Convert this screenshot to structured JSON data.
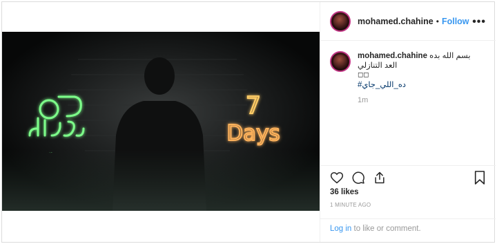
{
  "post": {
    "username": "mohamed.chahine",
    "dot": "•",
    "follow_label": "Follow",
    "more_label": "•••",
    "caption_line1": "بسم الله بده العد التنازلي",
    "caption_line2": "◻◻",
    "hashtag": "#ده_اللي_جاي",
    "time_short": "1m",
    "likes": "36 likes",
    "time_ago": "1 MINUTE AGO",
    "login_link": "Log in",
    "login_rest": " to like or comment."
  },
  "media": {
    "neon_left_text": "ده اللي جاي",
    "neon_right_number": "7",
    "neon_right_word": "Days",
    "colors": {
      "green_neon": "#7dff8a",
      "orange_neon": "#ffb35c",
      "purple_neon": "#c99cff",
      "background": "#0b0c0c"
    }
  },
  "icons": [
    "heart-icon",
    "comment-icon",
    "share-icon",
    "bookmark-icon"
  ],
  "colors": {
    "link": "#3897f0",
    "text": "#262626",
    "muted": "#999999",
    "border": "#dbdbdb"
  }
}
